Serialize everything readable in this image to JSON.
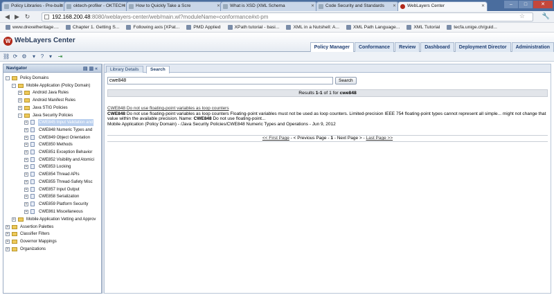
{
  "browser": {
    "tabs": [
      {
        "title": "Policy Libraries - Pre-built p",
        "active": false
      },
      {
        "title": "oktech-profiler - OKTECH",
        "active": false
      },
      {
        "title": "How to Quickly Take a Scre",
        "active": false
      },
      {
        "title": "What is XSD (XML Schema",
        "active": false
      },
      {
        "title": "Code Security and Standards",
        "active": false
      },
      {
        "title": "WebLayers Center",
        "active": true
      }
    ],
    "url_host": "192.168.200.48",
    "url_path": ":8080/weblayers-center/web/main.wl?moduleName=conformance#xt-pm",
    "bookmarks": [
      "www.drexelheritage....",
      "Chapter 1. Getting S...",
      "Following axis [XPat...",
      "PMD Applied",
      "XPath tutorial - basi...",
      "XML in a Nutshell: A...",
      "XML Path Language...",
      "XML Tutorial",
      "tecfa.unige.ch/guid..."
    ]
  },
  "app": {
    "logo_letter": "W",
    "title": "WebLayers Center",
    "nav": [
      "Policy Manager",
      "Conformance",
      "Review",
      "Dashboard",
      "Deployment Director",
      "Administration"
    ],
    "active_nav": "Policy Manager"
  },
  "navigator": {
    "title": "Navigator",
    "tree": [
      {
        "label": "Policy Domains",
        "level": 0,
        "exp": "-",
        "type": "folder"
      },
      {
        "label": "Mobile Application (Policy Domain)",
        "level": 1,
        "exp": "-",
        "type": "folder"
      },
      {
        "label": "Android Java Rules",
        "level": 2,
        "exp": "+",
        "type": "folder"
      },
      {
        "label": "Android Manifest Rules",
        "level": 2,
        "exp": "+",
        "type": "folder"
      },
      {
        "label": "Java STIG Policies",
        "level": 2,
        "exp": "+",
        "type": "folder"
      },
      {
        "label": "Java Security Policies",
        "level": 2,
        "exp": "-",
        "type": "folder"
      },
      {
        "label": "CWE845 Input Validation and",
        "level": 3,
        "exp": "+",
        "type": "doc",
        "selected": true
      },
      {
        "label": "CWE848 Numeric Types and",
        "level": 3,
        "exp": "+",
        "type": "doc"
      },
      {
        "label": "CWE849 Object Orientation",
        "level": 3,
        "exp": "+",
        "type": "doc"
      },
      {
        "label": "CWE850 Methods",
        "level": 3,
        "exp": "+",
        "type": "doc"
      },
      {
        "label": "CWE851 Exception Behavior",
        "level": 3,
        "exp": "+",
        "type": "doc"
      },
      {
        "label": "CWE852 Visibility and Atomici",
        "level": 3,
        "exp": "+",
        "type": "doc"
      },
      {
        "label": "CWE853 Locking",
        "level": 3,
        "exp": "+",
        "type": "doc"
      },
      {
        "label": "CWE854 Thread APIs",
        "level": 3,
        "exp": "+",
        "type": "doc"
      },
      {
        "label": "CWE855 Thread-Safety Misc",
        "level": 3,
        "exp": "+",
        "type": "doc"
      },
      {
        "label": "CWE857 Input Output",
        "level": 3,
        "exp": "+",
        "type": "doc"
      },
      {
        "label": "CWE858 Serialization",
        "level": 3,
        "exp": "+",
        "type": "doc"
      },
      {
        "label": "CWE859 Platform Security",
        "level": 3,
        "exp": "+",
        "type": "doc"
      },
      {
        "label": "CWE861 Miscellaneous",
        "level": 3,
        "exp": "+",
        "type": "doc"
      },
      {
        "label": "Mobile Application Vetting and Approv",
        "level": 1,
        "exp": "+",
        "type": "folder"
      },
      {
        "label": "Assertion Palettes",
        "level": 0,
        "exp": "+",
        "type": "folder"
      },
      {
        "label": "Classifier Filters",
        "level": 0,
        "exp": "+",
        "type": "folder"
      },
      {
        "label": "Governor Mappings",
        "level": 0,
        "exp": "+",
        "type": "folder"
      },
      {
        "label": "Organizations",
        "level": 0,
        "exp": "+",
        "type": "folder"
      }
    ]
  },
  "main": {
    "tabs": [
      "Library Details",
      "Search"
    ],
    "active_tab": "Search",
    "search_value": "cwe848",
    "search_button": "Search",
    "results_prefix": "Results ",
    "results_range": "1-1",
    "results_mid": " of 1 for ",
    "results_term": "cwe848",
    "result": {
      "title": "CWE848 Do not use floating-point variables as loop counters",
      "summary_bold": "CWE848",
      "summary_text": " Do not use floating-point variables as loop counters Floating-point variables must not be used as loop counters. Limited-precision IEEE 754 floating-point types cannot represent all simple... might not change that value within the available precision. Name: ",
      "name_bold": "CWE848",
      "name_text": " Do not use floating-point...",
      "path": "Mobile Application (Policy Domain) - /Java Security Policies/CWE848 Numeric Types and Operations - Jun 9, 2012"
    },
    "pager": {
      "first": "<< First Page",
      "sep1": " - ",
      "prev": "< Previous Page",
      "sep2": " - ",
      "current": "1",
      "sep3": " - ",
      "next": "Next Page >",
      "sep4": " - ",
      "last": "Last Page >>"
    }
  }
}
